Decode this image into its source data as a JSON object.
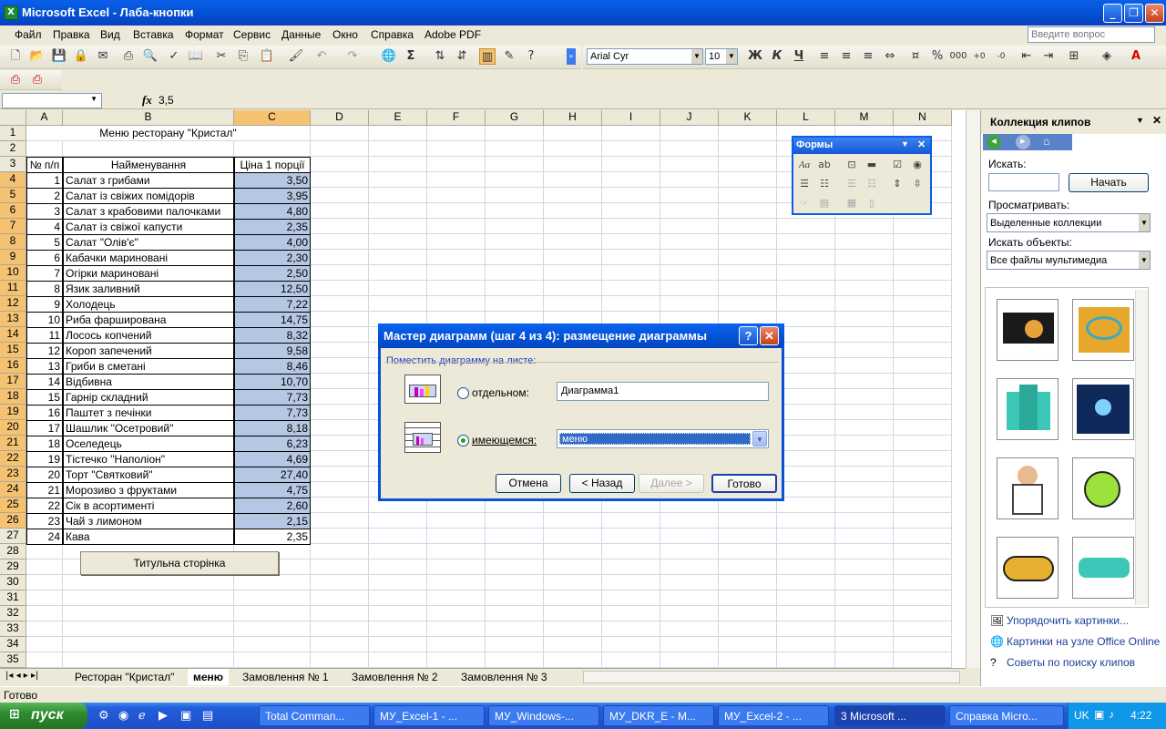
{
  "window": {
    "title": "Microsoft Excel - Лаба-кнопки"
  },
  "menu": {
    "items": [
      "Файл",
      "Правка",
      "Вид",
      "Вставка",
      "Формат",
      "Сервис",
      "Данные",
      "Окно",
      "Справка",
      "Adobe PDF"
    ],
    "ask_placeholder": "Введите вопрос"
  },
  "toolbar": {
    "font": "Arial Cyr",
    "size": "10",
    "bold": "Ж",
    "italic": "К",
    "underline": "Ч",
    "percent": "%",
    "thousands": "000"
  },
  "formula": {
    "fx": "fx",
    "value": "3,5"
  },
  "grid": {
    "columns": [
      "A",
      "B",
      "C",
      "D",
      "E",
      "F",
      "G",
      "H",
      "I",
      "J",
      "K",
      "L",
      "M",
      "N"
    ],
    "rows": [
      "1",
      "2",
      "3",
      "4",
      "5",
      "6",
      "7",
      "8",
      "9",
      "10",
      "11",
      "12",
      "13",
      "14",
      "15",
      "16",
      "17",
      "18",
      "19",
      "20",
      "21",
      "22",
      "23",
      "24",
      "25",
      "26",
      "27",
      "28",
      "29",
      "30",
      "31",
      "32",
      "33",
      "34",
      "35"
    ],
    "title": "Меню ресторану \"Кристал\"",
    "headers": [
      "№ п/п",
      "Найменування",
      "Ціна 1 порції"
    ],
    "items": [
      [
        "1",
        "Салат з грибами",
        "3,50"
      ],
      [
        "2",
        "Салат із свіжих помідорів",
        "3,95"
      ],
      [
        "3",
        "Салат з крабовими палочками",
        "4,80"
      ],
      [
        "4",
        "Салат із свіжої капусти",
        "2,35"
      ],
      [
        "5",
        "Салат \"Олів'є\"",
        "4,00"
      ],
      [
        "6",
        "Кабачки мариновані",
        "2,30"
      ],
      [
        "7",
        "Огірки мариновані",
        "2,50"
      ],
      [
        "8",
        "Язик заливний",
        "12,50"
      ],
      [
        "9",
        "Холодець",
        "7,22"
      ],
      [
        "10",
        "Риба фарширована",
        "14,75"
      ],
      [
        "11",
        "Лосось копчений",
        "8,32"
      ],
      [
        "12",
        "Короп запечений",
        "9,58"
      ],
      [
        "13",
        "Гриби в сметані",
        "8,46"
      ],
      [
        "14",
        "Відбивна",
        "10,70"
      ],
      [
        "15",
        "Гарнір складний",
        "7,73"
      ],
      [
        "16",
        "Паштет з печінки",
        "7,73"
      ],
      [
        "17",
        "Шашлик \"Осетровий\"",
        "8,18"
      ],
      [
        "18",
        "Оселедець",
        "6,23"
      ],
      [
        "19",
        "Тістечко \"Наполіон\"",
        "4,69"
      ],
      [
        "20",
        "Торт \"Святковий\"",
        "27,40"
      ],
      [
        "21",
        "Морозиво з фруктами",
        "4,75"
      ],
      [
        "22",
        "Сік в асортименті",
        "2,60"
      ],
      [
        "23",
        "Чай з лимоном",
        "2,15"
      ],
      [
        "24",
        "Кава",
        "2,35"
      ]
    ],
    "button": "Титульна сторінка"
  },
  "sheets": {
    "tabs": [
      "Ресторан \"Кристал\"",
      "меню",
      "Замовлення № 1",
      "Замовлення № 2",
      "Замовлення № 3"
    ],
    "active": "меню"
  },
  "status": "Готово",
  "forms": {
    "title": "Формы"
  },
  "clips": {
    "title": "Коллекция клипов",
    "search_label": "Искать:",
    "go": "Начать",
    "browse_label": "Просматривать:",
    "browse_value": "Выделенные коллекции",
    "types_label": "Искать объекты:",
    "types_value": "Все файлы мультимедиа",
    "links": [
      "Упорядочить картинки...",
      "Картинки на узле Office Online",
      "Советы по поиску клипов"
    ]
  },
  "dialog": {
    "title": "Мастер диаграмм (шаг 4 из 4): размещение диаграммы",
    "group": "Поместить диаграмму на листе:",
    "opt1": "отдельном:",
    "opt1_value": "Диаграмма1",
    "opt2": "имеющемся:",
    "opt2_value": "меню",
    "cancel": "Отмена",
    "back": "< Назад",
    "next": "Далее >",
    "finish": "Готово"
  },
  "taskbar": {
    "start": "пуск",
    "tasks": [
      "Total Comman...",
      "МУ_Excel-1 - ...",
      "МУ_Windows-...",
      "МУ_DKR_E - M...",
      "МУ_Excel-2 - ...",
      "3 Microsoft ...",
      "Справка Micro..."
    ],
    "lang": "UK",
    "clock": "4:22"
  },
  "colors": {
    "selection": "#b6c7e4",
    "header_sel": "#f5c272",
    "xp_blue": "#0a5ee8"
  }
}
